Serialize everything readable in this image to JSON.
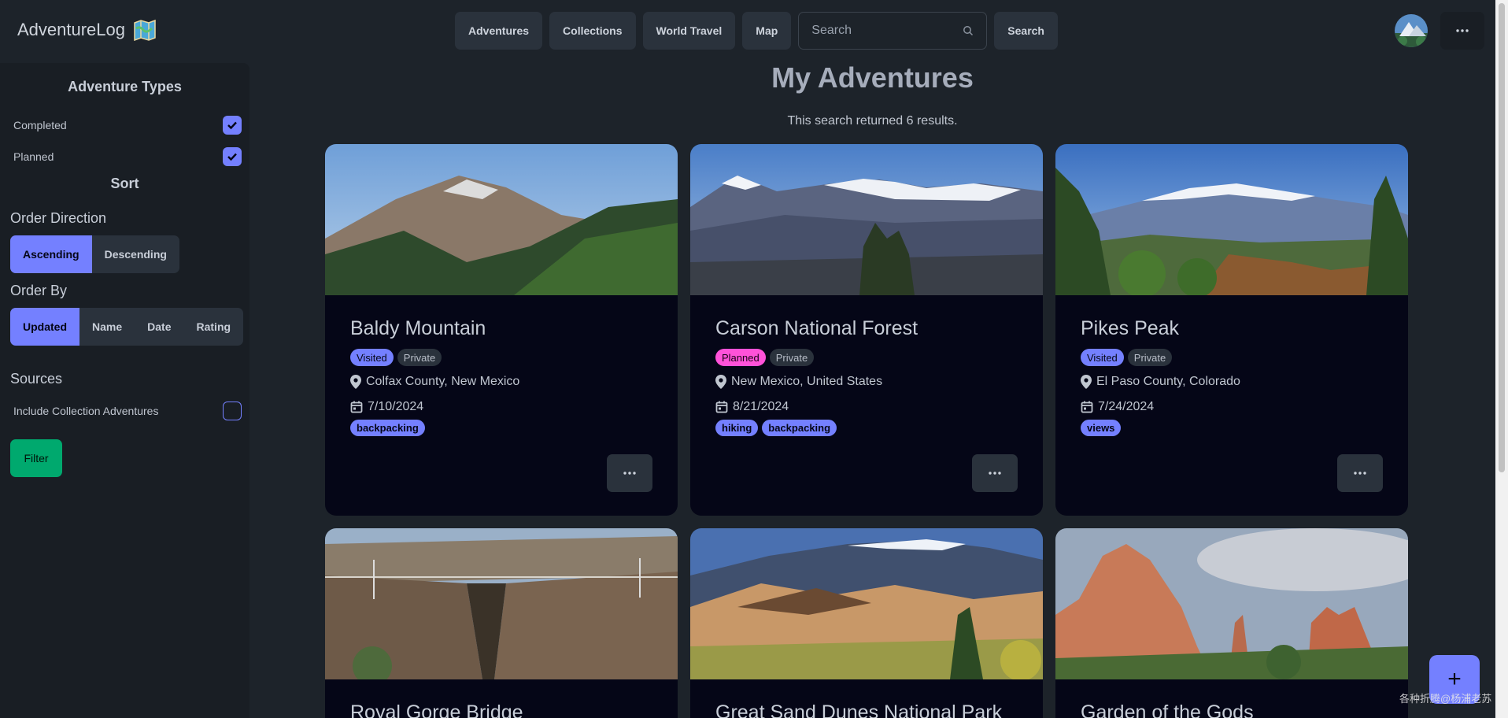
{
  "brand": {
    "name": "AdventureLog"
  },
  "nav": {
    "items": [
      "Adventures",
      "Collections",
      "World Travel",
      "Map"
    ],
    "search_placeholder": "Search",
    "search_button": "Search"
  },
  "sidebar": {
    "types_title": "Adventure Types",
    "types": [
      {
        "label": "Completed",
        "checked": true
      },
      {
        "label": "Planned",
        "checked": true
      }
    ],
    "sort_title": "Sort",
    "order_direction_title": "Order Direction",
    "order_direction": [
      "Ascending",
      "Descending"
    ],
    "order_direction_selected": "Ascending",
    "order_by_title": "Order By",
    "order_by": [
      "Updated",
      "Name",
      "Date",
      "Rating"
    ],
    "order_by_selected": "Updated",
    "sources_title": "Sources",
    "include_collection_label": "Include Collection Adventures",
    "include_collection_checked": false,
    "filter_button": "Filter"
  },
  "main": {
    "title": "My Adventures",
    "results_text": "This search returned 6 results."
  },
  "cards": [
    {
      "title": "Baldy Mountain",
      "status": "Visited",
      "visibility": "Private",
      "location": "Colfax County, New Mexico",
      "date": "7/10/2024",
      "tags": [
        "backpacking"
      ]
    },
    {
      "title": "Carson National Forest",
      "status": "Planned",
      "visibility": "Private",
      "location": "New Mexico, United States",
      "date": "8/21/2024",
      "tags": [
        "hiking",
        "backpacking"
      ]
    },
    {
      "title": "Pikes Peak",
      "status": "Visited",
      "visibility": "Private",
      "location": "El Paso County, Colorado",
      "date": "7/24/2024",
      "tags": [
        "views"
      ]
    },
    {
      "title": "Royal Gorge Bridge"
    },
    {
      "title": "Great Sand Dunes National Park"
    },
    {
      "title": "Garden of the Gods"
    }
  ],
  "fab": {
    "label": "+"
  },
  "watermark": "各种折腾@杨浦老苏",
  "colors": {
    "primary": "#7480ff",
    "secondary": "#ff52d9",
    "success": "#00a96e",
    "base": "#1d232a",
    "card": "#050617"
  }
}
